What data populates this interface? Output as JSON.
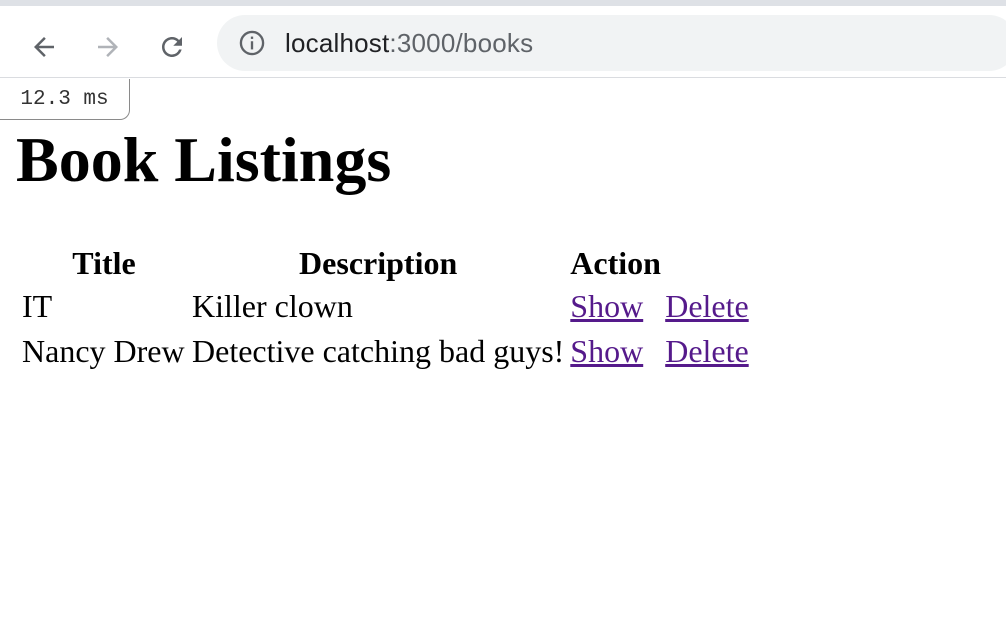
{
  "browser": {
    "url_host": "localhost",
    "url_path": ":3000/books"
  },
  "profiler": {
    "timing": "12.3 ms"
  },
  "page": {
    "title": "Book Listings"
  },
  "table": {
    "headers": [
      "Title",
      "Description",
      "Action"
    ],
    "rows": [
      {
        "title": "IT",
        "description": "Killer clown",
        "show": "Show",
        "delete": "Delete"
      },
      {
        "title": "Nancy Drew",
        "description": "Detective catching bad guys!",
        "show": "Show",
        "delete": "Delete"
      }
    ]
  },
  "colors": {
    "link": "#551a8b",
    "toolbar_bg": "#ffffff",
    "omnibox_bg": "#f1f3f4"
  }
}
